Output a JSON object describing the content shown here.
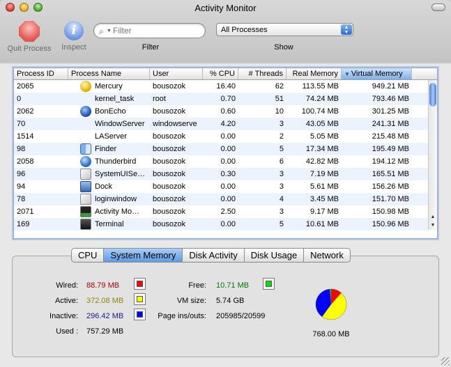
{
  "window": {
    "title": "Activity Monitor"
  },
  "toolbar": {
    "quit_label": "Quit Process",
    "inspect_label": "Inspect",
    "search_placeholder": "Filter",
    "filter_label": "Filter",
    "show_value": "All Processes",
    "show_label": "Show"
  },
  "table": {
    "columns": [
      "Process ID",
      "Process Name",
      "User",
      "% CPU",
      "# Threads",
      "Real Memory",
      "Virtual Memory"
    ],
    "sorted_column": "Virtual Memory",
    "rows": [
      {
        "pid": "2065",
        "name": "Mercury",
        "user": "bousozok",
        "cpu": "16.40",
        "threads": "62",
        "real": "113.55 MB",
        "virtual": "949.21 MB",
        "icon": "mercury-icon"
      },
      {
        "pid": "0",
        "name": "kernel_task",
        "user": "root",
        "cpu": "0.70",
        "threads": "51",
        "real": "74.24 MB",
        "virtual": "793.46 MB",
        "icon": ""
      },
      {
        "pid": "2062",
        "name": "BonEcho",
        "user": "bousozok",
        "cpu": "0.60",
        "threads": "10",
        "real": "100.74 MB",
        "virtual": "301.25 MB",
        "icon": "globe-icon"
      },
      {
        "pid": "70",
        "name": "WindowServer",
        "user": "windowserve",
        "cpu": "4.20",
        "threads": "3",
        "real": "43.05 MB",
        "virtual": "241.31 MB",
        "icon": ""
      },
      {
        "pid": "1514",
        "name": "LAServer",
        "user": "bousozok",
        "cpu": "0.00",
        "threads": "2",
        "real": "5.05 MB",
        "virtual": "215.48 MB",
        "icon": ""
      },
      {
        "pid": "98",
        "name": "Finder",
        "user": "bousozok",
        "cpu": "0.00",
        "threads": "5",
        "real": "17.34 MB",
        "virtual": "195.49 MB",
        "icon": "finder-icon"
      },
      {
        "pid": "2058",
        "name": "Thunderbird",
        "user": "bousozok",
        "cpu": "0.00",
        "threads": "6",
        "real": "42.82 MB",
        "virtual": "194.12 MB",
        "icon": "thunderbird-icon"
      },
      {
        "pid": "96",
        "name": "SystemUISe…",
        "user": "bousozok",
        "cpu": "0.30",
        "threads": "3",
        "real": "7.19 MB",
        "virtual": "165.51 MB",
        "icon": "app-icon"
      },
      {
        "pid": "94",
        "name": "Dock",
        "user": "bousozok",
        "cpu": "0.00",
        "threads": "3",
        "real": "5.61 MB",
        "virtual": "156.26 MB",
        "icon": "dock-icon"
      },
      {
        "pid": "78",
        "name": "loginwindow",
        "user": "bousozok",
        "cpu": "0.00",
        "threads": "4",
        "real": "3.45 MB",
        "virtual": "151.70 MB",
        "icon": "app-icon"
      },
      {
        "pid": "2071",
        "name": "Activity Mo…",
        "user": "bousozok",
        "cpu": "2.50",
        "threads": "3",
        "real": "9.17 MB",
        "virtual": "150.98 MB",
        "icon": "activity-monitor-icon"
      },
      {
        "pid": "169",
        "name": "Terminal",
        "user": "bousozok",
        "cpu": "0.00",
        "threads": "5",
        "real": "10.61 MB",
        "virtual": "150.96 MB",
        "icon": "terminal-icon"
      }
    ]
  },
  "tabs": [
    {
      "label": "CPU",
      "active": false
    },
    {
      "label": "System Memory",
      "active": true
    },
    {
      "label": "Disk Activity",
      "active": false
    },
    {
      "label": "Disk Usage",
      "active": false
    },
    {
      "label": "Network",
      "active": false
    }
  ],
  "memory": {
    "wired_label": "Wired:",
    "wired_value": "88.79 MB",
    "wired_color": "#ff0000",
    "wired_text_color": "#b00000",
    "active_label": "Active:",
    "active_value": "372.08 MB",
    "active_color": "#ffff00",
    "active_text_color": "#8a8a00",
    "inactive_label": "Inactive:",
    "inactive_value": "296.42 MB",
    "inactive_color": "#0000ff",
    "inactive_text_color": "#1a1a8c",
    "used_label": "Used :",
    "used_value": "757.29 MB",
    "free_label": "Free:",
    "free_value": "10.71 MB",
    "free_color": "#00e000",
    "free_text_color": "#007a00",
    "vmsize_label": "VM size:",
    "vmsize_value": "5.74 GB",
    "pageins_label": "Page ins/outs:",
    "pageins_value": "205985/20599",
    "total": "768.00 MB",
    "pie_mb": {
      "wired": 88.79,
      "active": 372.08,
      "inactive": 296.42,
      "free": 10.71
    }
  }
}
